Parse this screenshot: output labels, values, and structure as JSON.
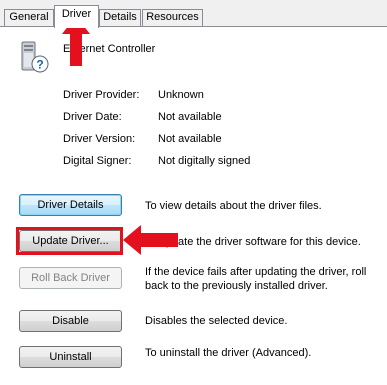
{
  "tabs": [
    {
      "label": "General"
    },
    {
      "label": "Driver"
    },
    {
      "label": "Details"
    },
    {
      "label": "Resources"
    }
  ],
  "device": {
    "name": "Ethernet Controller",
    "icon": "device-question-mark-icon"
  },
  "driver_info": {
    "provider_label": "Driver Provider:",
    "provider_value": "Unknown",
    "date_label": "Driver Date:",
    "date_value": "Not available",
    "version_label": "Driver Version:",
    "version_value": "Not available",
    "signer_label": "Digital Signer:",
    "signer_value": "Not digitally signed"
  },
  "buttons": {
    "details_label": "Driver Details",
    "details_desc": "To view details about the driver files.",
    "update_label": "Update Driver...",
    "update_desc": "To update the driver software for this device.",
    "rollback_label": "Roll Back Driver",
    "rollback_desc": "If the device fails after updating the driver, roll back to the previously installed driver.",
    "disable_label": "Disable",
    "disable_desc": "Disables the selected device.",
    "uninstall_label": "Uninstall",
    "uninstall_desc": "To uninstall the driver (Advanced)."
  },
  "annotation": {
    "color": "#e3101e"
  }
}
